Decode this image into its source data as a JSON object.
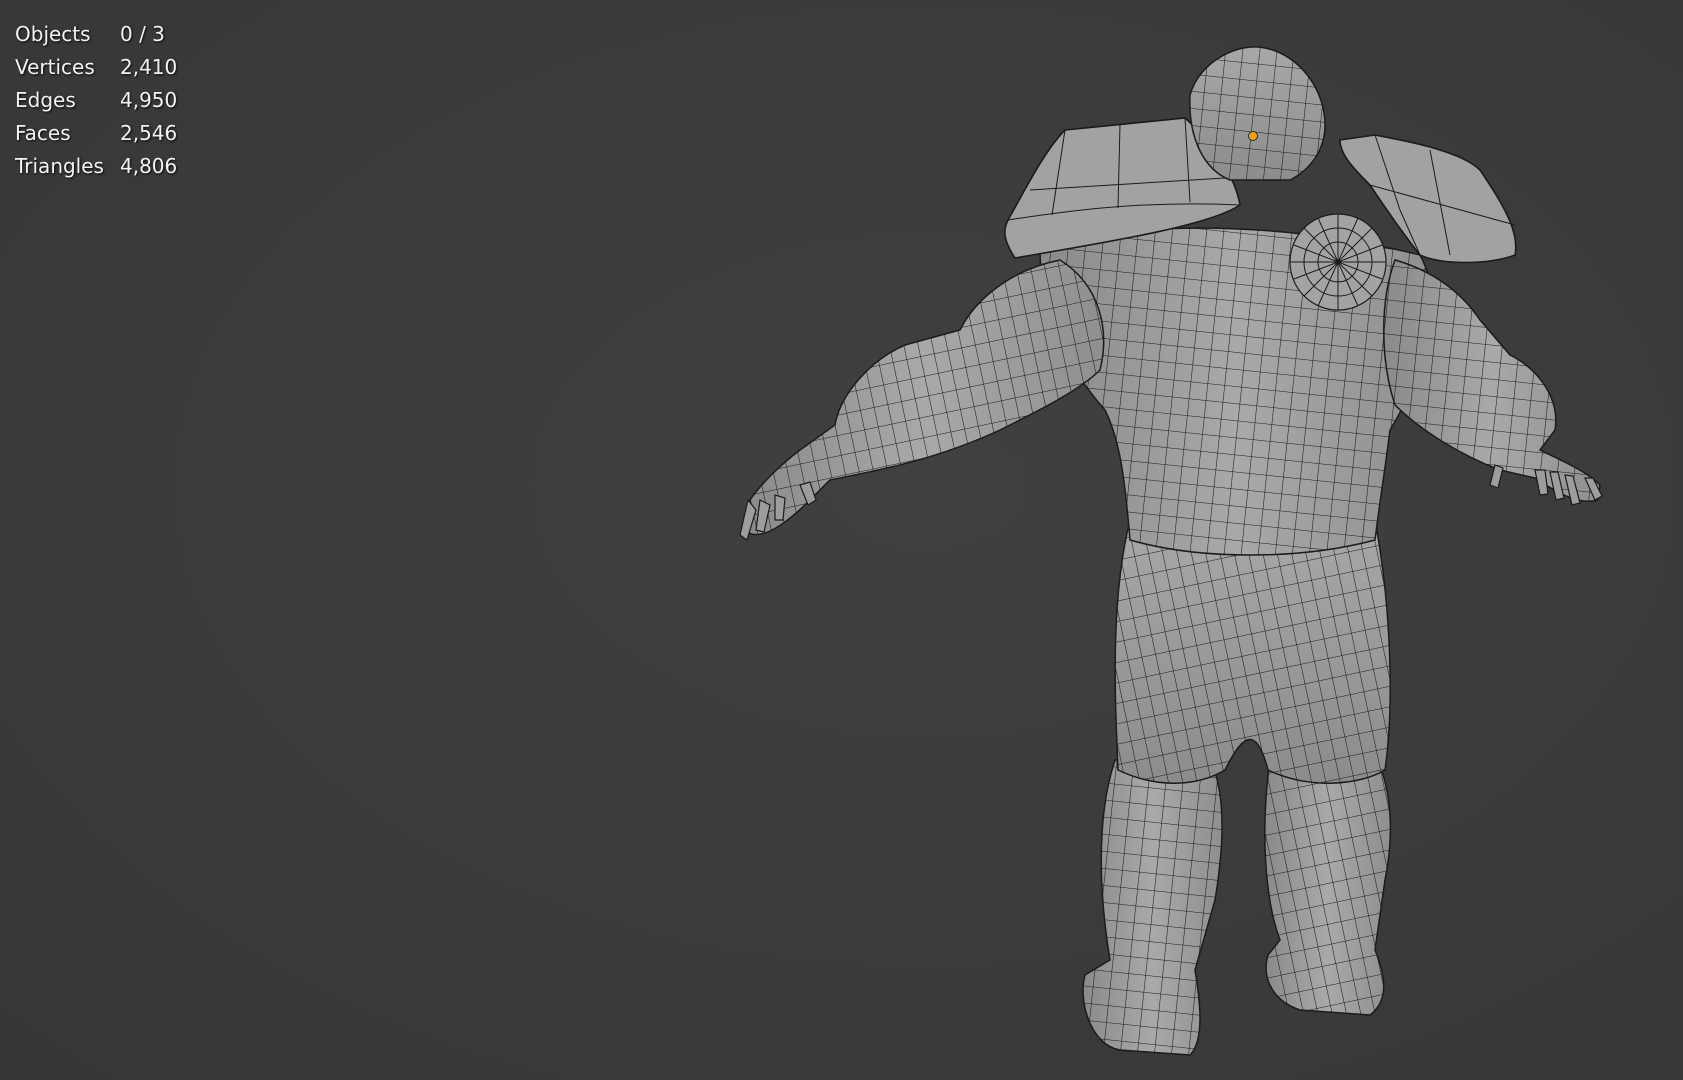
{
  "viewport": {
    "background_color": "#3a3a3a",
    "mesh_color": "#9a9a9a",
    "wire_color": "#1b1b1b",
    "origin_color": "#f0a020"
  },
  "statistics": [
    {
      "label": "Objects",
      "value": "0 / 3"
    },
    {
      "label": "Vertices",
      "value": "2,410"
    },
    {
      "label": "Edges",
      "value": "4,950"
    },
    {
      "label": "Faces",
      "value": "2,546"
    },
    {
      "label": "Triangles",
      "value": "4,806"
    }
  ]
}
